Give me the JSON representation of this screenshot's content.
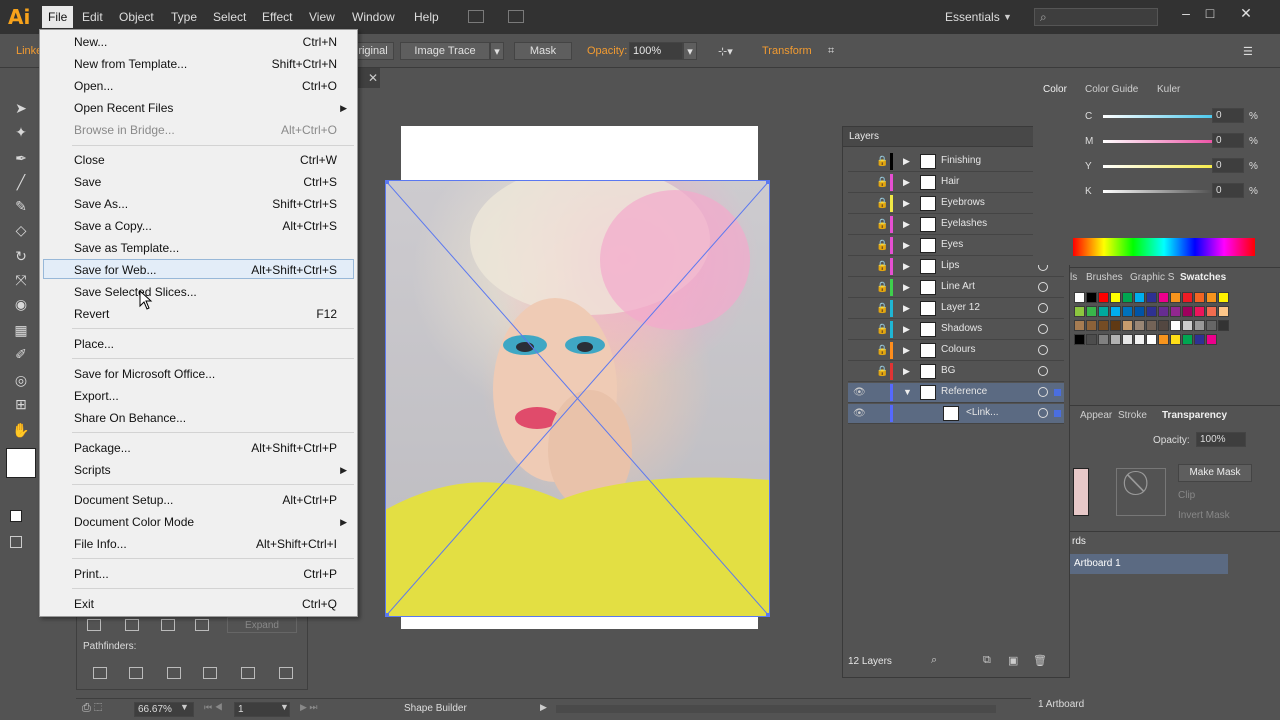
{
  "app": {
    "logo": "Ai",
    "menus": [
      "File",
      "Edit",
      "Object",
      "Type",
      "Select",
      "Effect",
      "View",
      "Window",
      "Help"
    ],
    "workspace": "Essentials",
    "window_controls": [
      "–",
      "□",
      "✕"
    ]
  },
  "controlbar": {
    "left_text": "Linke",
    "embed_label": "riginal",
    "image_trace": "Image Trace",
    "mask": "Mask",
    "opacity_label": "Opacity:",
    "opacity_value": "100%",
    "transform": "Transform"
  },
  "file_menu": {
    "items": [
      {
        "label": "New...",
        "shortcut": "Ctrl+N"
      },
      {
        "label": "New from Template...",
        "shortcut": "Shift+Ctrl+N"
      },
      {
        "label": "Open...",
        "shortcut": "Ctrl+O"
      },
      {
        "label": "Open Recent Files",
        "shortcut": ""
      },
      {
        "label": "Browse in Bridge...",
        "shortcut": "Alt+Ctrl+O"
      },
      {
        "label": "Close",
        "shortcut": "Ctrl+W"
      },
      {
        "label": "Save",
        "shortcut": "Ctrl+S"
      },
      {
        "label": "Save As...",
        "shortcut": "Shift+Ctrl+S"
      },
      {
        "label": "Save a Copy...",
        "shortcut": "Alt+Ctrl+S"
      },
      {
        "label": "Save as Template...",
        "shortcut": ""
      },
      {
        "label": "Save for Web...",
        "shortcut": "Alt+Shift+Ctrl+S"
      },
      {
        "label": "Save Selected Slices...",
        "shortcut": ""
      },
      {
        "label": "Revert",
        "shortcut": "F12"
      },
      {
        "label": "Place...",
        "shortcut": ""
      },
      {
        "label": "Save for Microsoft Office...",
        "shortcut": ""
      },
      {
        "label": "Export...",
        "shortcut": ""
      },
      {
        "label": "Share On Behance...",
        "shortcut": ""
      },
      {
        "label": "Package...",
        "shortcut": "Alt+Shift+Ctrl+P"
      },
      {
        "label": "Scripts",
        "shortcut": ""
      },
      {
        "label": "Document Setup...",
        "shortcut": "Alt+Ctrl+P"
      },
      {
        "label": "Document Color Mode",
        "shortcut": ""
      },
      {
        "label": "File Info...",
        "shortcut": "Alt+Shift+Ctrl+I"
      },
      {
        "label": "Print...",
        "shortcut": "Ctrl+P"
      },
      {
        "label": "Exit",
        "shortcut": "Ctrl+Q"
      }
    ]
  },
  "pathfinder": {
    "expand": "Expand",
    "label": "Pathfinders:"
  },
  "statusbar": {
    "zoom": "66.67%",
    "page": "1",
    "tool": "Shape Builder"
  },
  "layers": {
    "title": "Layers",
    "rows": [
      {
        "name": "Finishing",
        "color": "#000000"
      },
      {
        "name": "Hair",
        "color": "#e64fd2"
      },
      {
        "name": "Eyebrows",
        "color": "#f0e845"
      },
      {
        "name": "Eyelashes",
        "color": "#e64fd2"
      },
      {
        "name": "Eyes",
        "color": "#e64fd2"
      },
      {
        "name": "Lips",
        "color": "#e64fd2"
      },
      {
        "name": "Line Art",
        "color": "#3ed04d"
      },
      {
        "name": "Layer 12",
        "color": "#1fb6d4"
      },
      {
        "name": "Shadows",
        "color": "#1fb6d4"
      },
      {
        "name": "Colours",
        "color": "#ff8d1c"
      },
      {
        "name": "BG",
        "color": "#e03434"
      },
      {
        "name": "Reference",
        "color": "#5569ff"
      },
      {
        "name": "<Link...",
        "color": "#5569ff"
      }
    ],
    "count": "12 Layers"
  },
  "color_panel": {
    "tabs": [
      "Color",
      "Color Guide",
      "Kuler"
    ],
    "sliders": [
      {
        "label": "C",
        "value": "0",
        "color": "#1ab9e8"
      },
      {
        "label": "M",
        "value": "0",
        "color": "#e8248e"
      },
      {
        "label": "Y",
        "value": "0",
        "color": "#f4e61a"
      },
      {
        "label": "K",
        "value": "0",
        "color": "#222222"
      }
    ],
    "pct": "%"
  },
  "swatches_panel": {
    "tabs": [
      "ls",
      "Brushes",
      "Graphic S",
      "Swatches"
    ],
    "swatch_colors": [
      "#ffffff",
      "#000000",
      "#ff0000",
      "#ffff00",
      "#00a651",
      "#00aeef",
      "#2e3192",
      "#ec008c",
      "#f7941d",
      "#ed1c24",
      "#f26522",
      "#f7941d",
      "#fff200",
      "#8dc63f",
      "#39b54a",
      "#00a99d",
      "#00aeef",
      "#0072bc",
      "#0054a6",
      "#2e3192",
      "#662d91",
      "#92278f",
      "#9e005d",
      "#ed145b",
      "#f26c4f",
      "#fdc689",
      "#a67c52",
      "#8c6239",
      "#754c24",
      "#603913",
      "#c69c6d",
      "#998675",
      "#736357",
      "#534741",
      "#ffffff",
      "#cccccc",
      "#999999",
      "#666666",
      "#333333",
      "#000000",
      "#4d4d4d",
      "#808080",
      "#b3b3b3",
      "#e6e6e6",
      "#f2f2f2",
      "#ffffff",
      "#f7941d",
      "#ffde17",
      "#00a651",
      "#2e3192",
      "#ec008c"
    ]
  },
  "transparency_panel": {
    "tabs": [
      "Appear",
      "Stroke",
      "Transparency"
    ],
    "opacity_label": "Opacity:",
    "opacity_value": "100%",
    "make_mask": "Make Mask",
    "clip": "Clip",
    "invert_mask": "Invert Mask"
  },
  "artboards_panel": {
    "tab": "rds",
    "artboard_name": "Artboard 1",
    "count": "1 Artboard"
  }
}
